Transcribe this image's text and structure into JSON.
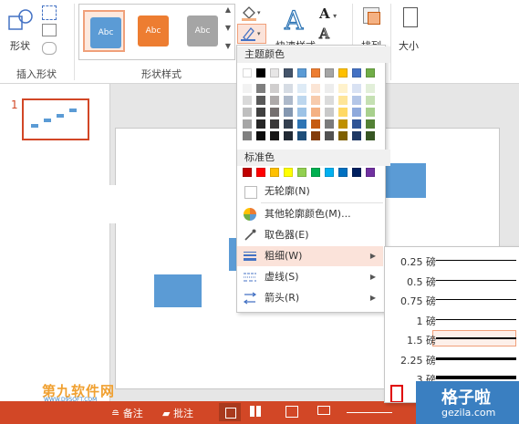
{
  "ribbon": {
    "shape_label": "形状",
    "insert_shapes_group": "插入形状",
    "shape_styles_group": "形状样式",
    "style_items": [
      {
        "text": "Abc",
        "color": "#5b9bd5",
        "selected": true
      },
      {
        "text": "Abc",
        "color": "#ed7d31",
        "selected": false
      },
      {
        "text": "Abc",
        "color": "#a5a5a5",
        "selected": false
      }
    ],
    "quick_styles_label": "快速样式",
    "arrange_label": "排列",
    "size_label": "大小"
  },
  "slides_pane": {
    "slide_number": "1"
  },
  "outline_menu": {
    "theme_colors_header": "主题颜色",
    "standard_colors_header": "标准色",
    "theme_top_row": [
      "#ffffff",
      "#000000",
      "#e7e6e6",
      "#44546a",
      "#5b9bd5",
      "#ed7d31",
      "#a5a5a5",
      "#ffc000",
      "#4472c4",
      "#70ad47"
    ],
    "theme_shade_columns": [
      [
        "#f2f2f2",
        "#d9d9d9",
        "#bfbfbf",
        "#a6a6a6",
        "#808080"
      ],
      [
        "#7f7f7f",
        "#595959",
        "#404040",
        "#262626",
        "#0d0d0d"
      ],
      [
        "#d0cece",
        "#aeaaaa",
        "#757070",
        "#3a3838",
        "#171616"
      ],
      [
        "#d6dce4",
        "#adb9ca",
        "#8497b0",
        "#333f50",
        "#222a35"
      ],
      [
        "#deebf6",
        "#bdd7ee",
        "#9dc3e6",
        "#2e75b5",
        "#1f4e79"
      ],
      [
        "#fbe5d5",
        "#f7cbac",
        "#f4b183",
        "#c55a11",
        "#833c0b"
      ],
      [
        "#ededed",
        "#dbdbdb",
        "#c9c9c9",
        "#7b7b7b",
        "#525252"
      ],
      [
        "#fff2cc",
        "#fee599",
        "#ffd965",
        "#bf9000",
        "#7f6000"
      ],
      [
        "#d9e2f3",
        "#b4c6e7",
        "#8faadc",
        "#2f5496",
        "#1f3864"
      ],
      [
        "#e2efd9",
        "#c5e0b3",
        "#a8d08d",
        "#538135",
        "#375623"
      ]
    ],
    "standard_colors": [
      "#c00000",
      "#ff0000",
      "#ffc000",
      "#ffff00",
      "#92d050",
      "#00b050",
      "#00b0f0",
      "#0070c0",
      "#002060",
      "#7030a0"
    ],
    "no_outline": "无轮廓(N)",
    "more_colors": "其他轮廓颜色(M)...",
    "eyedropper": "取色器(E)",
    "weight": "粗细(W)",
    "dashes": "虚线(S)",
    "arrows": "箭头(R)"
  },
  "weight_menu": {
    "items": [
      {
        "label": "0.25 磅",
        "pt": 0.25
      },
      {
        "label": "0.5 磅",
        "pt": 0.5
      },
      {
        "label": "0.75 磅",
        "pt": 0.75
      },
      {
        "label": "1 磅",
        "pt": 1
      },
      {
        "label": "1.5 磅",
        "pt": 1.5,
        "selected": true
      },
      {
        "label": "2.25 磅",
        "pt": 2.25
      },
      {
        "label": "3 磅",
        "pt": 3
      }
    ]
  },
  "status_bar": {
    "notes": "备注",
    "comments": "批注"
  },
  "watermarks": {
    "left_text": "第九软件网",
    "left_sub": "WWW.D9SOFT.COM",
    "right_text": "格子啦",
    "right_sub": "gezila.com"
  },
  "colors": {
    "accent": "#d24726",
    "shape_blue": "#5b9bd5",
    "highlight": "#fbe3da"
  }
}
